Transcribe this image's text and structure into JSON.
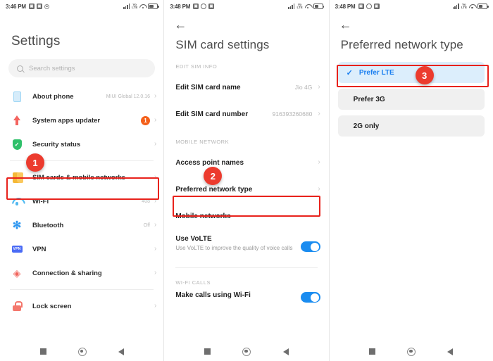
{
  "screens": [
    {
      "statusbar": {
        "time": "3:46 PM",
        "icons_left": [
          "screenshot-icon",
          "screenshot-icon",
          "record-icon"
        ],
        "icons_right": [
          "signal-bars-icon",
          "mobile-data-icon",
          "wifi-icon",
          "battery-icon"
        ],
        "data_label": "Vo\nLTE"
      },
      "title": "Settings",
      "search": {
        "placeholder": "Search settings"
      },
      "items": [
        {
          "label": "About phone",
          "value": "MIUI Global 12.0.16",
          "icon": "phone-icon",
          "badge": ""
        },
        {
          "label": "System apps updater",
          "value": "",
          "icon": "up-arrow-icon",
          "badge": "1"
        },
        {
          "label": "Security status",
          "value": "",
          "icon": "shield-icon",
          "badge": ""
        },
        {
          "label": "SIM cards & mobile networks",
          "value": "",
          "icon": "sim-card-icon",
          "badge": ""
        },
        {
          "label": "Wi-Fi",
          "value": "408",
          "icon": "wifi-icon",
          "badge": ""
        },
        {
          "label": "Bluetooth",
          "value": "Off",
          "icon": "bluetooth-icon",
          "badge": ""
        },
        {
          "label": "VPN",
          "value": "",
          "icon": "vpn-icon",
          "badge": ""
        },
        {
          "label": "Connection & sharing",
          "value": "",
          "icon": "connection-sharing-icon",
          "badge": ""
        },
        {
          "label": "Lock screen",
          "value": "",
          "icon": "lock-icon",
          "badge": ""
        }
      ],
      "step_badge": "1"
    },
    {
      "statusbar": {
        "time": "3:48 PM",
        "icons_left": [
          "screenshot-icon",
          "whatsapp-icon",
          "screenshot-icon"
        ],
        "icons_right": [
          "signal-bars-icon",
          "mobile-data-icon",
          "wifi-icon",
          "battery-icon"
        ]
      },
      "title": "SIM card settings",
      "sections": [
        {
          "header": "EDIT SIM INFO",
          "rows": [
            {
              "label": "Edit SIM card name",
              "value": "Jio 4G"
            },
            {
              "label": "Edit SIM card number",
              "value": "916393260680"
            }
          ]
        },
        {
          "header": "MOBILE NETWORK",
          "rows": [
            {
              "label": "Access point names",
              "value": ""
            },
            {
              "label": "Preferred network type",
              "value": ""
            },
            {
              "label": "Mobile networks",
              "value": ""
            }
          ]
        }
      ],
      "volte": {
        "title": "Use VoLTE",
        "subtitle": "Use VoLTE to improve the quality of voice calls",
        "enabled": true
      },
      "wifi_calls": {
        "header": "WI-FI CALLS",
        "label": "Make calls using Wi-Fi",
        "enabled": true
      },
      "step_badge": "2"
    },
    {
      "statusbar": {
        "time": "3:48 PM",
        "icons_left": [
          "screenshot-icon",
          "whatsapp-icon",
          "screenshot-icon"
        ],
        "icons_right": [
          "signal-bars-icon",
          "mobile-data-icon",
          "wifi-icon",
          "battery-icon"
        ]
      },
      "title": "Preferred network type",
      "options": [
        {
          "label": "Prefer LTE",
          "selected": true
        },
        {
          "label": "Prefer 3G",
          "selected": false
        },
        {
          "label": "2G only",
          "selected": false
        }
      ],
      "step_badge": "3"
    }
  ],
  "navbar": {
    "recents": "recents-icon",
    "home": "home-icon",
    "back": "back-icon"
  },
  "colors": {
    "accent_blue": "#1a7ff0",
    "highlight_red": "#e8221c",
    "step_badge": "#ec3b2e",
    "selected_row_bg": "#dceefc",
    "option_bg": "#f0f0f0"
  }
}
